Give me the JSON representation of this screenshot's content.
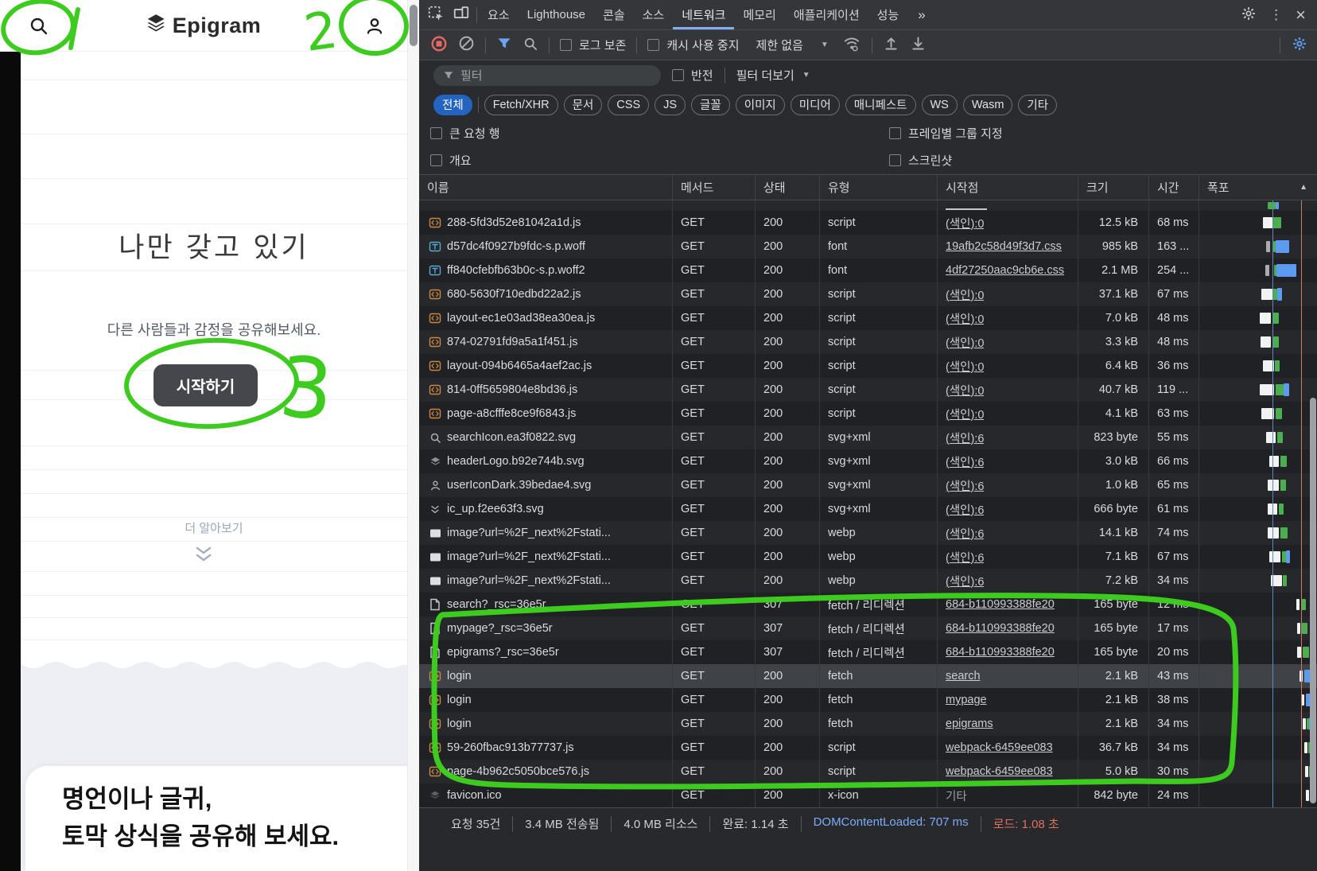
{
  "annotation": {
    "color": "#3ecb1f",
    "numbers": {
      "n1": "1",
      "n2": "2",
      "n3": "3"
    }
  },
  "page": {
    "logo_text": "Epigram",
    "hero": {
      "title": "나만 갖고 있기",
      "subtitle": "다른 사람들과 감정을 공유해보세요.",
      "cta_label": "시작하기",
      "more_label": "더 알아보기"
    },
    "promo": {
      "line1": "명언이나 글귀,",
      "line2": "토막 상식을 공유해 보세요."
    }
  },
  "devtools": {
    "tabs": [
      "요소",
      "Lighthouse",
      "콘솔",
      "소스",
      "네트워크",
      "메모리",
      "애플리케이션",
      "성능"
    ],
    "selected_tab": "네트워크",
    "more_tabs_glyph": "»",
    "toolbar": {
      "preserve_log": "로그 보존",
      "disable_cache": "캐시 사용 중지",
      "throttling": "제한 없음"
    },
    "filter": {
      "placeholder": "필터",
      "invert": "반전",
      "more_filters": "필터 더보기"
    },
    "chips": [
      "전체",
      "Fetch/XHR",
      "문서",
      "CSS",
      "JS",
      "글꼴",
      "이미지",
      "미디어",
      "매니페스트",
      "WS",
      "Wasm",
      "기타"
    ],
    "selected_chip": "전체",
    "options": {
      "big_rows": "큰 요청 행",
      "group_by_frame": "프레임별 그룹 지정",
      "overview": "개요",
      "screenshots": "스크린샷"
    },
    "table": {
      "columns": [
        "이름",
        "메서드",
        "상태",
        "유형",
        "시작점",
        "크기",
        "시간",
        "폭포"
      ],
      "rows": [
        {
          "partial": true,
          "wf": [
            [
              "g",
              86,
              10
            ],
            [
              "b",
              96,
              4
            ]
          ]
        },
        {
          "icon": "script-icon",
          "name": "288-5fd3d52e81042a1d.js",
          "method": "GET",
          "status": "200",
          "type": "script",
          "initiator": "(색인):0",
          "link": true,
          "size": "12.5 kB",
          "time": "68 ms",
          "wf": [
            [
              "w",
              80,
              12
            ],
            [
              "g",
              92,
              11
            ]
          ]
        },
        {
          "icon": "font-icon",
          "name": "d57dc4f0927b9fdc-s.p.woff",
          "method": "GET",
          "status": "200",
          "type": "font",
          "initiator": "19afb2c58d49f3d7.css",
          "link": true,
          "size": "985 kB",
          "time": "163 ...",
          "wf": [
            [
              "gy",
              84,
              5
            ],
            [
              "g",
              93,
              3
            ],
            [
              "b",
              96,
              17
            ]
          ]
        },
        {
          "icon": "font-icon",
          "name": "ff840cfebfb63b0c-s.p.woff2",
          "method": "GET",
          "status": "200",
          "type": "font",
          "initiator": "4df27250aac9cb6e.css",
          "link": true,
          "size": "2.1 MB",
          "time": "254 ...",
          "wf": [
            [
              "gy",
              83,
              5
            ],
            [
              "g",
              94,
              3
            ],
            [
              "b",
              97,
              25
            ]
          ]
        },
        {
          "icon": "script-icon",
          "name": "680-5630f710edbd22a2.js",
          "method": "GET",
          "status": "200",
          "type": "script",
          "initiator": "(색인):0",
          "link": true,
          "size": "37.1 kB",
          "time": "67 ms",
          "wf": [
            [
              "w",
              78,
              14
            ],
            [
              "g",
              92,
              6
            ],
            [
              "b",
              98,
              6
            ]
          ]
        },
        {
          "icon": "script-icon",
          "name": "layout-ec1e03ad38ea30ea.js",
          "method": "GET",
          "status": "200",
          "type": "script",
          "initiator": "(색인):0",
          "link": true,
          "size": "7.0 kB",
          "time": "48 ms",
          "wf": [
            [
              "w",
              76,
              14
            ],
            [
              "g",
              92,
              8
            ]
          ]
        },
        {
          "icon": "script-icon",
          "name": "874-02791fd9a5a1f451.js",
          "method": "GET",
          "status": "200",
          "type": "script",
          "initiator": "(색인):0",
          "link": true,
          "size": "3.3 kB",
          "time": "48 ms",
          "wf": [
            [
              "w",
              77,
              13
            ],
            [
              "g",
              92,
              8
            ]
          ]
        },
        {
          "icon": "script-icon",
          "name": "layout-094b6465a4aef2ac.js",
          "method": "GET",
          "status": "200",
          "type": "script",
          "initiator": "(색인):0",
          "link": true,
          "size": "6.4 kB",
          "time": "36 ms",
          "wf": [
            [
              "w",
              80,
              14
            ],
            [
              "g",
              95,
              6
            ]
          ]
        },
        {
          "icon": "script-icon",
          "name": "814-0ff5659804e8bd36.js",
          "method": "GET",
          "status": "200",
          "type": "script",
          "initiator": "(색인):0",
          "link": true,
          "size": "40.7 kB",
          "time": "119 ...",
          "wf": [
            [
              "w",
              76,
              18
            ],
            [
              "g",
              96,
              10
            ],
            [
              "b",
              106,
              7
            ]
          ]
        },
        {
          "icon": "script-icon",
          "name": "page-a8cfffe8ce9f6843.js",
          "method": "GET",
          "status": "200",
          "type": "script",
          "initiator": "(색인):0",
          "link": true,
          "size": "4.1 kB",
          "time": "63 ms",
          "wf": [
            [
              "w",
              78,
              16
            ],
            [
              "g",
              96,
              8
            ]
          ]
        },
        {
          "icon": "search-preview-icon",
          "name": "searchIcon.ea3f0822.svg",
          "method": "GET",
          "status": "200",
          "type": "svg+xml",
          "initiator": "(색인):6",
          "link": true,
          "size": "823 byte",
          "time": "55 ms",
          "wf": [
            [
              "w",
              84,
              12
            ],
            [
              "g",
              98,
              7
            ]
          ]
        },
        {
          "icon": "logo-preview-icon",
          "name": "headerLogo.b92e744b.svg",
          "method": "GET",
          "status": "200",
          "type": "svg+xml",
          "initiator": "(색인):6",
          "link": true,
          "size": "3.0 kB",
          "time": "66 ms",
          "wf": [
            [
              "w",
              88,
              12
            ],
            [
              "g",
              102,
              8
            ]
          ]
        },
        {
          "icon": "user-preview-icon",
          "name": "userIconDark.39bedae4.svg",
          "method": "GET",
          "status": "200",
          "type": "svg+xml",
          "initiator": "(색인):6",
          "link": true,
          "size": "1.0 kB",
          "time": "65 ms",
          "wf": [
            [
              "w",
              86,
              14
            ],
            [
              "g",
              102,
              7
            ]
          ]
        },
        {
          "icon": "chevron-preview-icon",
          "name": "ic_up.f2ee63f3.svg",
          "method": "GET",
          "status": "200",
          "type": "svg+xml",
          "initiator": "(색인):6",
          "link": true,
          "size": "666 byte",
          "time": "61 ms",
          "wf": [
            [
              "w",
              86,
              12
            ],
            [
              "g",
              100,
              6
            ]
          ]
        },
        {
          "icon": "image-icon",
          "name": "image?url=%2F_next%2Fstati...",
          "method": "GET",
          "status": "200",
          "type": "webp",
          "initiator": "(색인):6",
          "link": true,
          "size": "14.1 kB",
          "time": "74 ms",
          "wf": [
            [
              "w",
              86,
              14
            ],
            [
              "g",
              102,
              9
            ]
          ]
        },
        {
          "icon": "image-icon",
          "name": "image?url=%2F_next%2Fstati...",
          "method": "GET",
          "status": "200",
          "type": "webp",
          "initiator": "(색인):6",
          "link": true,
          "size": "7.1 kB",
          "time": "67 ms",
          "wf": [
            [
              "w",
              88,
              14
            ],
            [
              "g",
              104,
              5
            ],
            [
              "b",
              109,
              5
            ]
          ]
        },
        {
          "icon": "image-icon",
          "name": "image?url=%2F_next%2Fstati...",
          "method": "GET",
          "status": "200",
          "type": "webp",
          "initiator": "(색인):6",
          "link": true,
          "size": "7.2 kB",
          "time": "34 ms",
          "wf": [
            [
              "w",
              90,
              14
            ],
            [
              "g",
              105,
              5
            ]
          ]
        },
        {
          "icon": "document-icon",
          "name": "search?_rsc=36e5r",
          "method": "GET",
          "status": "307",
          "type": "fetch / 리디렉션",
          "initiator": "684-b110993388fe20",
          "link": true,
          "size": "165 byte",
          "time": "12 ms",
          "wf": [
            [
              "w",
              122,
              4
            ],
            [
              "g",
              128,
              6
            ]
          ]
        },
        {
          "icon": "document-icon",
          "name": "mypage?_rsc=36e5r",
          "method": "GET",
          "status": "307",
          "type": "fetch / 리디렉션",
          "initiator": "684-b110993388fe20",
          "link": true,
          "size": "165 byte",
          "time": "17 ms",
          "wf": [
            [
              "w",
              123,
              4
            ],
            [
              "g",
              129,
              7
            ]
          ]
        },
        {
          "icon": "document-icon",
          "name": "epigrams?_rsc=36e5r",
          "method": "GET",
          "status": "307",
          "type": "fetch / 리디렉션",
          "initiator": "684-b110993388fe20",
          "link": true,
          "size": "165 byte",
          "time": "20 ms",
          "wf": [
            [
              "w",
              123,
              5
            ],
            [
              "g",
              130,
              8
            ]
          ]
        },
        {
          "icon": "script-icon",
          "name": "login",
          "method": "GET",
          "status": "200",
          "type": "fetch",
          "initiator": "search",
          "link": true,
          "highlight": true,
          "size": "2.1 kB",
          "time": "43 ms",
          "wf": [
            [
              "w",
              126,
              4
            ],
            [
              "b",
              132,
              11
            ]
          ]
        },
        {
          "icon": "script-icon",
          "name": "login",
          "method": "GET",
          "status": "200",
          "type": "fetch",
          "initiator": "mypage",
          "link": true,
          "size": "2.1 kB",
          "time": "38 ms",
          "wf": [
            [
              "w",
              128,
              4
            ],
            [
              "b",
              134,
              9
            ]
          ]
        },
        {
          "icon": "script-icon",
          "name": "login",
          "method": "GET",
          "status": "200",
          "type": "fetch",
          "initiator": "epigrams",
          "link": true,
          "size": "2.1 kB",
          "time": "34 ms",
          "wf": [
            [
              "w",
              130,
              4
            ],
            [
              "g",
              135,
              3
            ],
            [
              "b",
              138,
              7
            ]
          ]
        },
        {
          "icon": "script-icon",
          "name": "59-260fbac913b77737.js",
          "method": "GET",
          "status": "200",
          "type": "script",
          "initiator": "webpack-6459ee083",
          "link": true,
          "size": "36.7 kB",
          "time": "34 ms",
          "wf": [
            [
              "w",
              132,
              4
            ],
            [
              "g",
              137,
              8
            ]
          ]
        },
        {
          "icon": "script-icon",
          "name": "page-4b962c5050bce576.js",
          "method": "GET",
          "status": "200",
          "type": "script",
          "initiator": "webpack-6459ee083",
          "link": true,
          "size": "5.0 kB",
          "time": "30 ms",
          "wf": [
            [
              "w",
              133,
              4
            ],
            [
              "g",
              138,
              6
            ]
          ]
        },
        {
          "icon": "favicon-preview-icon",
          "name": "favicon.ico",
          "method": "GET",
          "status": "200",
          "type": "x-icon",
          "initiator": "기타",
          "link": false,
          "size": "842 byte",
          "time": "24 ms",
          "wf": [
            [
              "w",
              134,
              4
            ],
            [
              "g",
              139,
              5
            ]
          ]
        }
      ]
    },
    "status_bar": [
      {
        "text": "요청 35건"
      },
      {
        "text": "3.4 MB 전송됨"
      },
      {
        "text": "4.0 MB 리소스"
      },
      {
        "text": "완료: 1.14 초"
      },
      {
        "text": "DOMContentLoaded: 707 ms",
        "color": "blue"
      },
      {
        "text": "로드: 1.08 초",
        "color": "red"
      }
    ]
  }
}
